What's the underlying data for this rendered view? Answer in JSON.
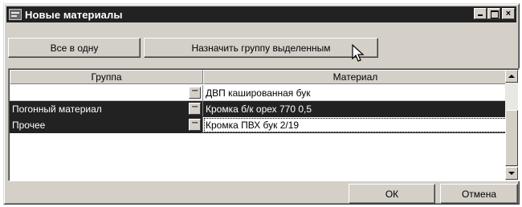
{
  "window": {
    "title": "Новые материалы",
    "app_icon": "app-icon",
    "controls": [
      "minimize-icon",
      "maximize-icon",
      "close-icon"
    ],
    "close_glyph": "×"
  },
  "toolbar": {
    "all_in_one_label": "Все в одну",
    "assign_group_label": "Назначить группу выделенным"
  },
  "grid": {
    "columns": [
      "Группа",
      "Материал"
    ],
    "ellipsis_glyph": "···",
    "rows": [
      {
        "group": "",
        "material": "ДВП кашированная бук",
        "selected": false
      },
      {
        "group": "Погонный материал",
        "material": "Кромка б/к орех 770 0,5",
        "selected": true
      },
      {
        "group": "Прочее",
        "material": "Кромка ПВХ бук 2/19",
        "selected": true
      }
    ]
  },
  "footer": {
    "ok_label": "ОК",
    "cancel_label": "Отмена"
  }
}
